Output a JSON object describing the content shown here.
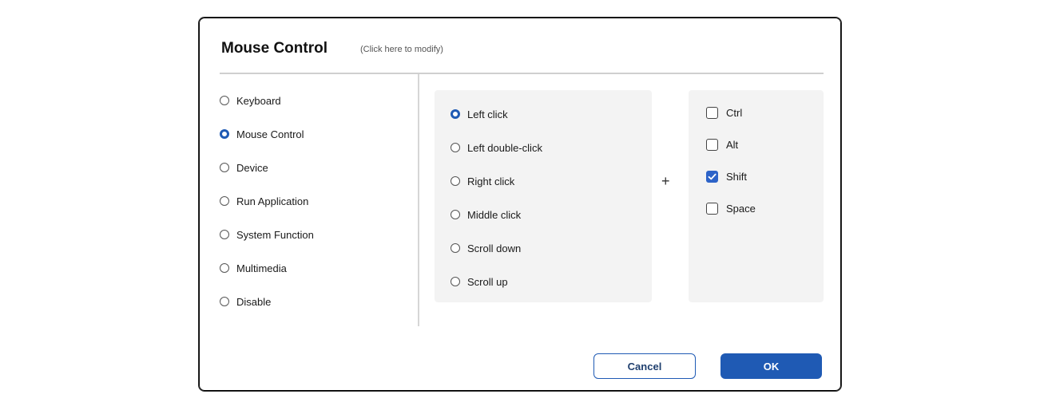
{
  "dialog": {
    "title": "Mouse Control",
    "subtitle": "(Click here to modify)"
  },
  "nav": {
    "items": [
      {
        "label": "Keyboard",
        "selected": false
      },
      {
        "label": "Mouse Control",
        "selected": true
      },
      {
        "label": "Device",
        "selected": false
      },
      {
        "label": "Run Application",
        "selected": false
      },
      {
        "label": "System Function",
        "selected": false
      },
      {
        "label": "Multimedia",
        "selected": false
      },
      {
        "label": "Disable",
        "selected": false
      }
    ]
  },
  "clicks": {
    "options": [
      {
        "label": "Left click",
        "selected": true
      },
      {
        "label": "Left double-click",
        "selected": false
      },
      {
        "label": "Right click",
        "selected": false
      },
      {
        "label": "Middle click",
        "selected": false
      },
      {
        "label": "Scroll down",
        "selected": false
      },
      {
        "label": "Scroll up",
        "selected": false
      }
    ]
  },
  "plus_sign": "+",
  "modifiers": {
    "items": [
      {
        "label": "Ctrl",
        "checked": false
      },
      {
        "label": "Alt",
        "checked": false
      },
      {
        "label": "Shift",
        "checked": true
      },
      {
        "label": "Space",
        "checked": false
      }
    ]
  },
  "buttons": {
    "cancel_label": "Cancel",
    "ok_label": "OK"
  },
  "colors": {
    "accent": "#1f5ab4",
    "panel_bg": "#f3f3f3"
  }
}
